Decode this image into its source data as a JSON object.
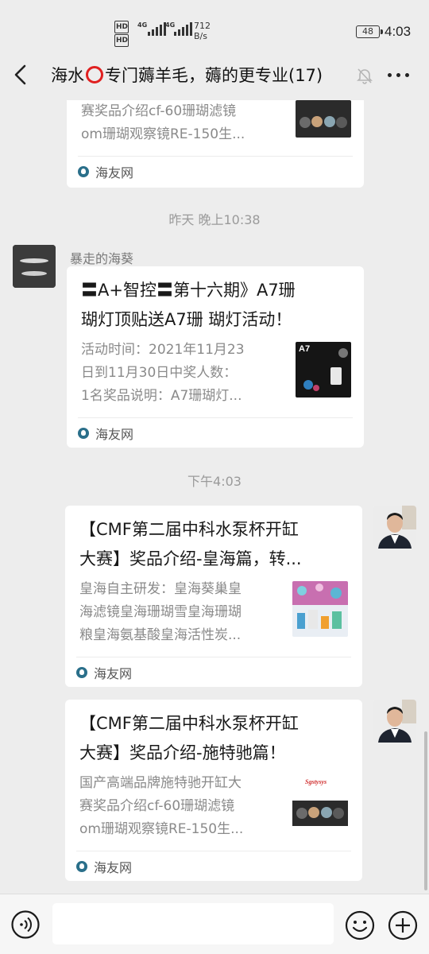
{
  "status_bar": {
    "hd1": "HD",
    "hd2": "HD",
    "net1": "4G",
    "net2": "4G",
    "speed_value": "712",
    "speed_unit": "B/s",
    "battery": "48",
    "time": "4:03"
  },
  "nav": {
    "title_before": "海水",
    "title_after": "专门薅羊毛，薅的更专业(17)",
    "back_icon": "chevron-left-icon",
    "mute_icon": "bell-muted-icon",
    "more_icon": "more-dots-icon"
  },
  "messages": [
    {
      "desc_line1": "赛奖品介绍cf-60珊瑚滤镜",
      "desc_line2": "om珊瑚观察镜RE-150生...",
      "source": "海友网"
    },
    {
      "timestamp": "昨天 晚上10:38",
      "sender": "暴走的海葵",
      "title_line1": "〓A+智控〓第十六期》A7珊",
      "title_line2": "瑚灯顶贴送A7珊 瑚灯活动！",
      "desc_line1": "活动时间：2021年11月23",
      "desc_line2": "日到11月30日中奖人数：",
      "desc_line3": "1名奖品说明：A7珊瑚灯...",
      "thumb_label": "A7",
      "source": "海友网"
    },
    {
      "timestamp": "下午4:03",
      "title_line1": "【CMF第二届中科水泵杯开缸",
      "title_line2": "大赛】奖品介绍-皇海篇，转...",
      "desc_line1": "皇海自主研发：皇海葵巢皇",
      "desc_line2": "海滤镜皇海珊瑚雪皇海珊瑚",
      "desc_line3": "粮皇海氨基酸皇海活性炭...",
      "source": "海友网"
    },
    {
      "title_line1": "【CMF第二届中科水泵杯开缸",
      "title_line2": "大赛】奖品介绍-施特驰篇！",
      "desc_line1": "国产高端品牌施特驰开缸大",
      "desc_line2": "赛奖品介绍cf-60珊瑚滤镜",
      "desc_line3": "om珊瑚观察镜RE-150生...",
      "thumb_label": "Sgstysys",
      "source": "海友网"
    }
  ],
  "input_bar": {
    "voice_icon": "voice-icon",
    "emoji_icon": "emoji-icon",
    "plus_icon": "plus-icon"
  },
  "colors": {
    "background": "#ededed",
    "card": "#ffffff",
    "accent_red": "#e02020",
    "desc_gray": "#8a8a8a"
  }
}
